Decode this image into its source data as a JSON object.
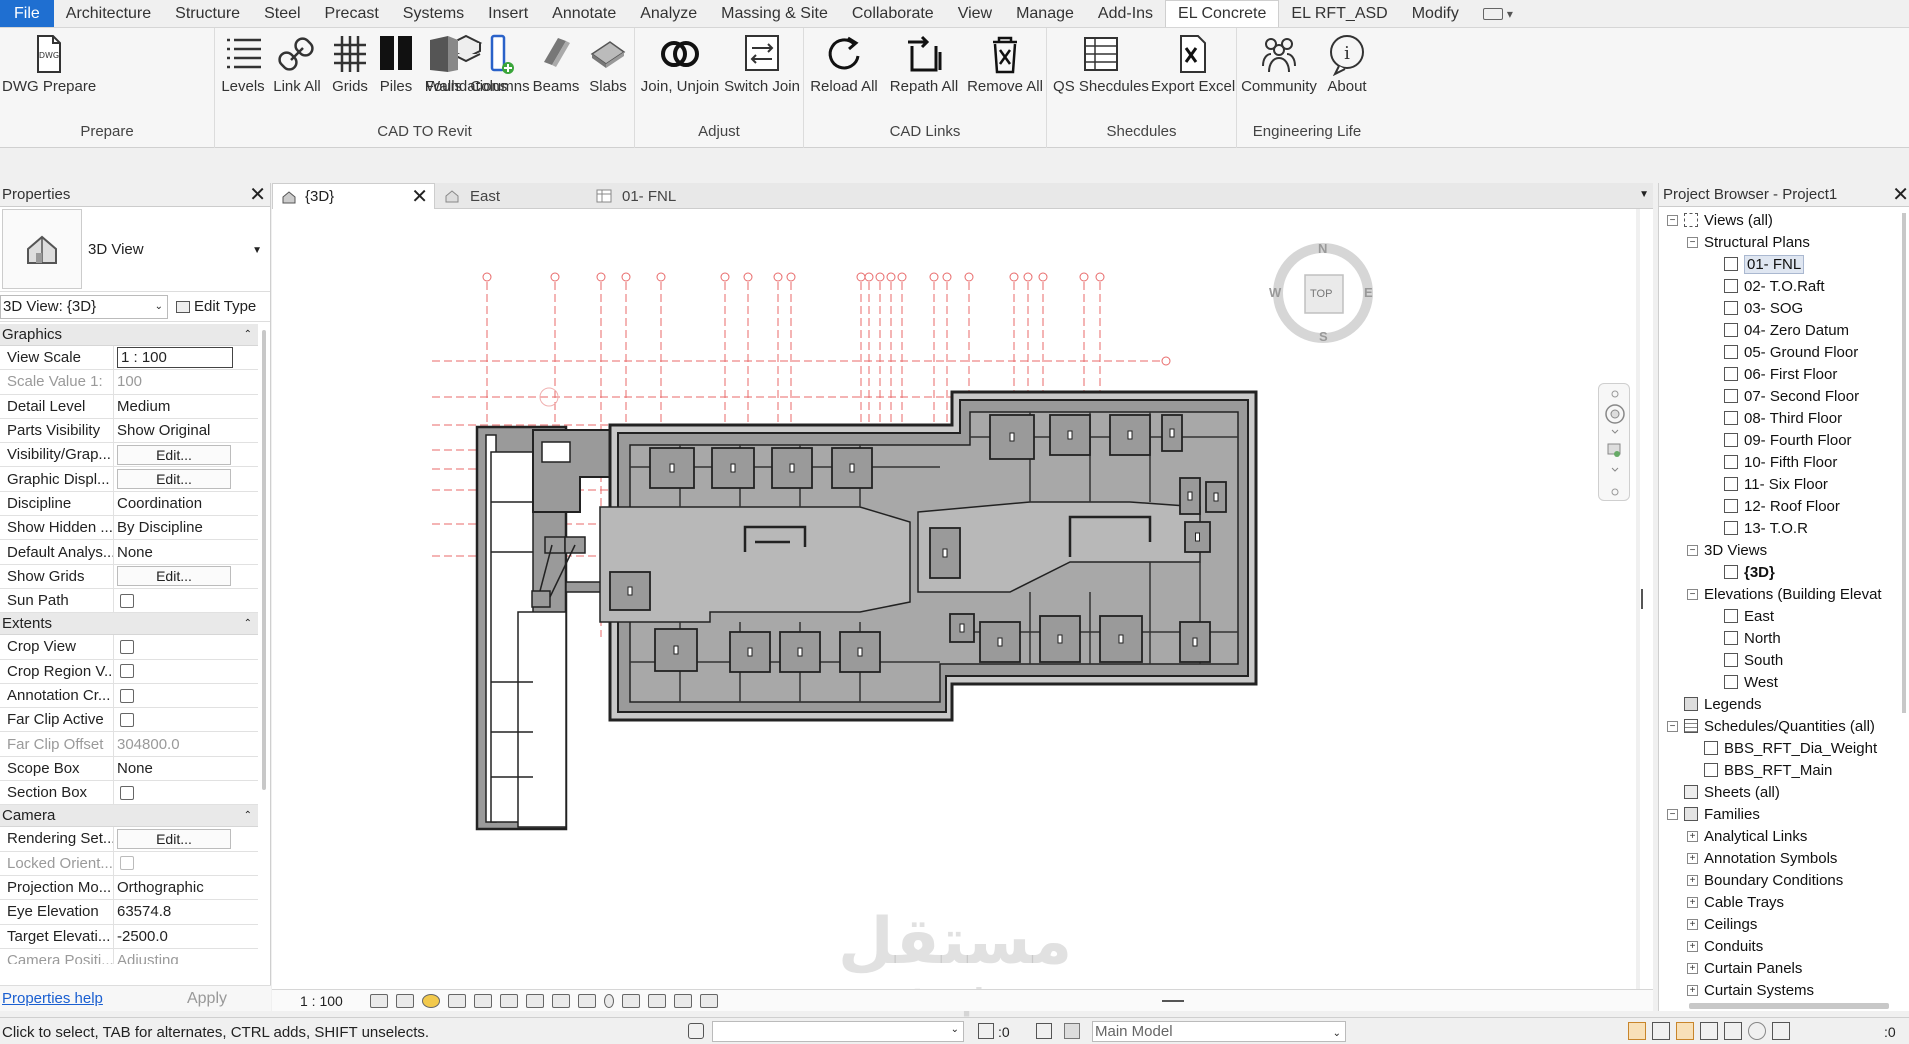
{
  "menu": {
    "tabs": [
      "File",
      "Architecture",
      "Structure",
      "Steel",
      "Precast",
      "Systems",
      "Insert",
      "Annotate",
      "Analyze",
      "Massing & Site",
      "Collaborate",
      "View",
      "Manage",
      "Add-Ins",
      "EL Concrete",
      "EL RFT_ASD",
      "Modify"
    ],
    "active_tab": "EL Concrete"
  },
  "ribbon": {
    "panels": [
      {
        "title": "Prepare",
        "buttons": [
          "DWG Prepare"
        ]
      },
      {
        "title": "CAD TO Revit",
        "buttons": [
          "Levels",
          "Link All",
          "Grids",
          "Piles",
          "Foundations",
          "Walls",
          "Columns",
          "Beams",
          "Slabs"
        ]
      },
      {
        "title": "Adjust",
        "buttons": [
          "Join, Unjoin",
          "Switch Join"
        ]
      },
      {
        "title": "CAD Links",
        "buttons": [
          "Reload All",
          "Repath All",
          "Remove All"
        ]
      },
      {
        "title": "Shecdules",
        "buttons": [
          "QS Shecdules",
          "Export Excel"
        ]
      },
      {
        "title": "Engineering Life",
        "buttons": [
          "Community",
          "About"
        ]
      }
    ],
    "dwg_icon_text": "DWG"
  },
  "properties": {
    "title": "Properties",
    "type_name": "3D View",
    "instance_selector": "3D View: {3D}",
    "edit_type": "Edit Type",
    "categories": [
      {
        "name": "Graphics",
        "rows": [
          {
            "name": "View Scale",
            "value": "1 : 100",
            "kind": "box"
          },
          {
            "name": "Scale Value    1:",
            "value": "100",
            "kind": "dim"
          },
          {
            "name": "Detail Level",
            "value": "Medium",
            "kind": "text"
          },
          {
            "name": "Parts Visibility",
            "value": "Show Original",
            "kind": "text"
          },
          {
            "name": "Visibility/Grap...",
            "value": "Edit...",
            "kind": "button"
          },
          {
            "name": "Graphic Displ...",
            "value": "Edit...",
            "kind": "button"
          },
          {
            "name": "Discipline",
            "value": "Coordination",
            "kind": "text"
          },
          {
            "name": "Show Hidden ...",
            "value": "By Discipline",
            "kind": "text"
          },
          {
            "name": "Default Analys...",
            "value": "None",
            "kind": "text"
          },
          {
            "name": "Show Grids",
            "value": "Edit...",
            "kind": "button"
          },
          {
            "name": "Sun Path",
            "value": "",
            "kind": "check"
          }
        ]
      },
      {
        "name": "Extents",
        "rows": [
          {
            "name": "Crop View",
            "value": "",
            "kind": "check"
          },
          {
            "name": "Crop Region V...",
            "value": "",
            "kind": "check"
          },
          {
            "name": "Annotation Cr...",
            "value": "",
            "kind": "check"
          },
          {
            "name": "Far Clip Active",
            "value": "",
            "kind": "check"
          },
          {
            "name": "Far Clip Offset",
            "value": "304800.0",
            "kind": "dim"
          },
          {
            "name": "Scope Box",
            "value": "None",
            "kind": "text"
          },
          {
            "name": "Section Box",
            "value": "",
            "kind": "check"
          }
        ]
      },
      {
        "name": "Camera",
        "rows": [
          {
            "name": "Rendering Set...",
            "value": "Edit...",
            "kind": "button"
          },
          {
            "name": "Locked Orient...",
            "value": "",
            "kind": "dimcheck"
          },
          {
            "name": "Projection Mo...",
            "value": "Orthographic",
            "kind": "text"
          },
          {
            "name": "Eye Elevation",
            "value": "63574.8",
            "kind": "text"
          },
          {
            "name": "Target Elevati...",
            "value": "-2500.0",
            "kind": "text"
          },
          {
            "name": "Camera Positi...",
            "value": "Adjusting",
            "kind": "dim"
          }
        ]
      }
    ],
    "help_link": "Properties help",
    "apply": "Apply"
  },
  "view_tabs": [
    {
      "label": "{3D}",
      "active": true
    },
    {
      "label": "East",
      "active": false
    },
    {
      "label": "01- FNL",
      "active": false
    }
  ],
  "viewcube": {
    "face": "TOP",
    "n": "N",
    "s": "S",
    "e": "E",
    "w": "W"
  },
  "view_bar": {
    "scale": "1 : 100"
  },
  "browser": {
    "title": "Project Browser - Project1",
    "tree": [
      {
        "level": 0,
        "exp": "-",
        "icon": "views",
        "label": "Views (all)"
      },
      {
        "level": 1,
        "exp": "-",
        "icon": "none",
        "label": "Structural Plans"
      },
      {
        "level": 2,
        "exp": "",
        "icon": "view",
        "label": "01- FNL",
        "selected": true
      },
      {
        "level": 2,
        "exp": "",
        "icon": "view",
        "label": "02- T.O.Raft"
      },
      {
        "level": 2,
        "exp": "",
        "icon": "view",
        "label": "03- SOG"
      },
      {
        "level": 2,
        "exp": "",
        "icon": "view",
        "label": "04- Zero Datum"
      },
      {
        "level": 2,
        "exp": "",
        "icon": "view",
        "label": "05- Ground Floor"
      },
      {
        "level": 2,
        "exp": "",
        "icon": "view",
        "label": "06- First Floor"
      },
      {
        "level": 2,
        "exp": "",
        "icon": "view",
        "label": "07- Second Floor"
      },
      {
        "level": 2,
        "exp": "",
        "icon": "view",
        "label": "08- Third Floor"
      },
      {
        "level": 2,
        "exp": "",
        "icon": "view",
        "label": "09- Fourth Floor"
      },
      {
        "level": 2,
        "exp": "",
        "icon": "view",
        "label": "10- Fifth Floor"
      },
      {
        "level": 2,
        "exp": "",
        "icon": "view",
        "label": "11- Six Floor"
      },
      {
        "level": 2,
        "exp": "",
        "icon": "view",
        "label": "12- Roof Floor"
      },
      {
        "level": 2,
        "exp": "",
        "icon": "view",
        "label": "13- T.O.R"
      },
      {
        "level": 1,
        "exp": "-",
        "icon": "none",
        "label": "3D Views"
      },
      {
        "level": 2,
        "exp": "",
        "icon": "view",
        "label": "{3D}",
        "bold": true
      },
      {
        "level": 1,
        "exp": "-",
        "icon": "none",
        "label": "Elevations (Building Elevat"
      },
      {
        "level": 2,
        "exp": "",
        "icon": "view",
        "label": "East"
      },
      {
        "level": 2,
        "exp": "",
        "icon": "view",
        "label": "North"
      },
      {
        "level": 2,
        "exp": "",
        "icon": "view",
        "label": "South"
      },
      {
        "level": 2,
        "exp": "",
        "icon": "view",
        "label": "West"
      },
      {
        "level": 0,
        "exp": "",
        "icon": "legend",
        "label": "Legends"
      },
      {
        "level": 0,
        "exp": "-",
        "icon": "schedule",
        "label": "Schedules/Quantities (all)"
      },
      {
        "level": 1,
        "exp": "",
        "icon": "view",
        "label": "BBS_RFT_Dia_Weight"
      },
      {
        "level": 1,
        "exp": "",
        "icon": "view",
        "label": "BBS_RFT_Main"
      },
      {
        "level": 0,
        "exp": "",
        "icon": "sheet",
        "label": "Sheets (all)"
      },
      {
        "level": 0,
        "exp": "-",
        "icon": "family",
        "label": "Families"
      },
      {
        "level": 1,
        "exp": "+",
        "icon": "none",
        "label": "Analytical Links"
      },
      {
        "level": 1,
        "exp": "+",
        "icon": "none",
        "label": "Annotation Symbols"
      },
      {
        "level": 1,
        "exp": "+",
        "icon": "none",
        "label": "Boundary Conditions"
      },
      {
        "level": 1,
        "exp": "+",
        "icon": "none",
        "label": "Cable Trays"
      },
      {
        "level": 1,
        "exp": "+",
        "icon": "none",
        "label": "Ceilings"
      },
      {
        "level": 1,
        "exp": "+",
        "icon": "none",
        "label": "Conduits"
      },
      {
        "level": 1,
        "exp": "+",
        "icon": "none",
        "label": "Curtain Panels"
      },
      {
        "level": 1,
        "exp": "+",
        "icon": "none",
        "label": "Curtain Systems"
      }
    ]
  },
  "status": {
    "text": "Click to select, TAB for alternates, CTRL adds, SHIFT unselects.",
    "zero1": ":0",
    "model": "Main Model",
    "filter_count": ":0"
  },
  "watermark": {
    "arabic": "مستقل",
    "latin": "mostaql.com"
  },
  "colors": {
    "file_tab": "#1f6fd1",
    "grid_line": "#e86a6a",
    "slab_fill": "#9a9a9a",
    "link": "#1a5fd1"
  }
}
